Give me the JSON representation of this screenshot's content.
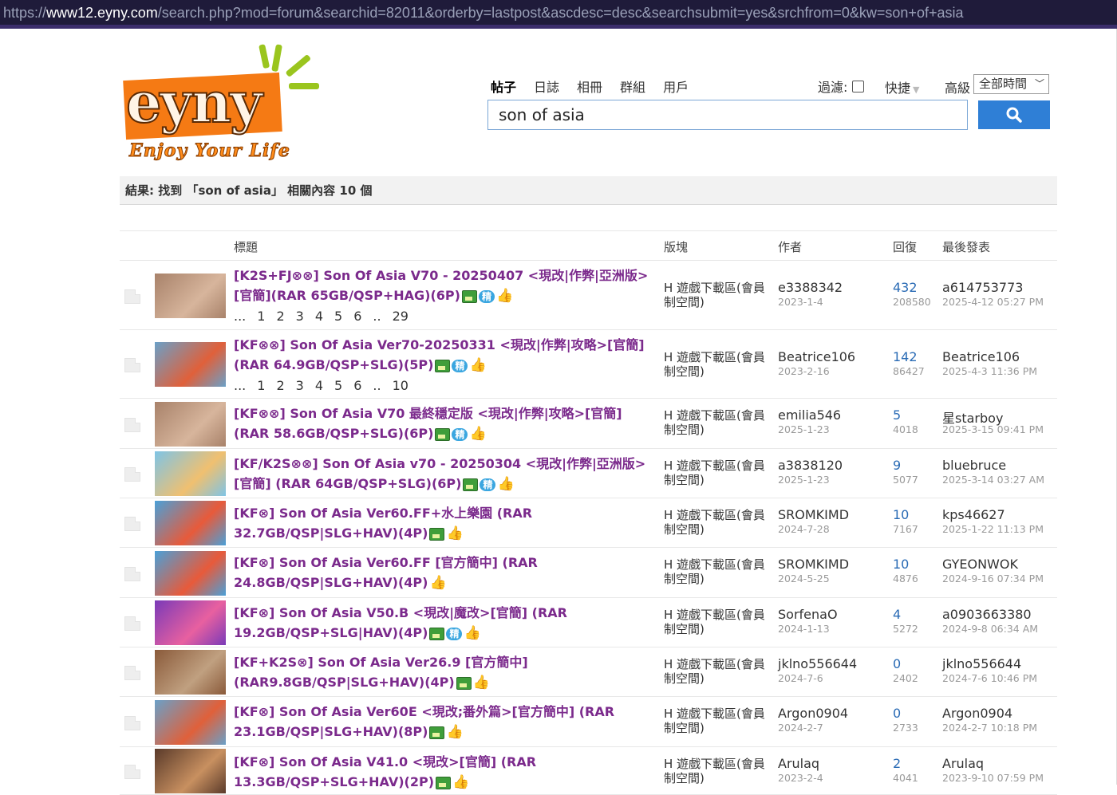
{
  "url": {
    "prefix": "https://",
    "host": "www12.eyny.com",
    "path": "/search.php?mod=forum&searchid=82011&orderby=lastpost&ascdesc=desc&searchsubmit=yes&srchfrom=0&kw=son+of+asia"
  },
  "logo": {
    "word": "eyny",
    "tagline": "Enjoy Your Life"
  },
  "search": {
    "tabs": [
      "帖子",
      "日誌",
      "相冊",
      "群組",
      "用戶"
    ],
    "filter_label": "過濾:",
    "quick_label": "快捷",
    "advanced_label": "高級",
    "time_select": "全部時間",
    "query": "son of asia"
  },
  "result_summary": "結果: 找到 「son of asia」 相關內容 10 個",
  "table": {
    "headers": {
      "title": "標題",
      "forum": "版塊",
      "author": "作者",
      "replies": "回復",
      "last_post": "最後發表"
    },
    "rows": [
      {
        "title": "[K2S+FJ⊗⊗] Son Of Asia V70 - 20250407 <現改|作弊|亞洲版> [官簡](RAR 65GB/QSP+HAG)(6P)",
        "badges": [
          "img",
          "jing",
          "thumb"
        ],
        "pages": [
          "...",
          "1",
          "2",
          "3",
          "4",
          "5",
          "6",
          "..",
          "29"
        ],
        "forum": "H 遊戲下載區(會員制空間)",
        "author": "e3388342",
        "author_date": "2023-1-4",
        "replies": "432",
        "views": "208580",
        "last_by": "a614753773",
        "last_date": "2025-4-12 05:27 PM"
      },
      {
        "title": "[KF⊗⊗] Son Of Asia Ver70-20250331 <現改|作弊|攻略>[官簡] (RAR 64.9GB/QSP+SLG)(5P)",
        "badges": [
          "img",
          "jing",
          "thumb"
        ],
        "pages": [
          "...",
          "1",
          "2",
          "3",
          "4",
          "5",
          "6",
          "..",
          "10"
        ],
        "forum": "H 遊戲下載區(會員制空間)",
        "author": "Beatrice106",
        "author_date": "2023-2-16",
        "replies": "142",
        "views": "86427",
        "last_by": "Beatrice106",
        "last_date": "2025-4-3 11:36 PM"
      },
      {
        "title": "[KF⊗⊗] Son Of Asia V70 最終穩定版 <現改|作弊|攻略>[官簡](RAR 58.6GB/QSP+SLG)(6P)",
        "badges": [
          "img",
          "jing",
          "thumb"
        ],
        "pages": [],
        "forum": "H 遊戲下載區(會員制空間)",
        "author": "emilia546",
        "author_date": "2025-1-23",
        "replies": "5",
        "views": "4018",
        "last_by": "星starboy",
        "last_date": "2025-3-15 09:41 PM"
      },
      {
        "title": "[KF/K2S⊗⊗] Son Of Asia v70 - 20250304 <現改|作弊|亞洲版>[官簡] (RAR 64GB/QSP+SLG)(6P)",
        "badges": [
          "img",
          "jing",
          "thumb"
        ],
        "pages": [],
        "forum": "H 遊戲下載區(會員制空間)",
        "author": "a3838120",
        "author_date": "2025-1-23",
        "replies": "9",
        "views": "5077",
        "last_by": "bluebruce",
        "last_date": "2025-3-14 03:27 AM"
      },
      {
        "title": "[KF⊗] Son Of Asia Ver60.FF+水上樂園 (RAR 32.7GB/QSP|SLG+HAV)(4P)",
        "badges": [
          "img",
          "thumb"
        ],
        "pages": [],
        "forum": "H 遊戲下載區(會員制空間)",
        "author": "SROMKIMD",
        "author_date": "2024-7-28",
        "replies": "10",
        "views": "7167",
        "last_by": "kps46627",
        "last_date": "2025-1-22 11:13 PM"
      },
      {
        "title": "[KF⊗] Son Of Asia Ver60.FF [官方簡中] (RAR 24.8GB/QSP|SLG+HAV)(4P)",
        "badges": [
          "thumb"
        ],
        "pages": [],
        "forum": "H 遊戲下載區(會員制空間)",
        "author": "SROMKIMD",
        "author_date": "2024-5-25",
        "replies": "10",
        "views": "4876",
        "last_by": "GYEONWOK",
        "last_date": "2024-9-16 07:34 PM"
      },
      {
        "title": "[KF⊗] Son Of Asia V50.B <現改|魔改>[官簡] (RAR 19.2GB/QSP+SLG|HAV)(4P)",
        "badges": [
          "img",
          "jing",
          "thumb"
        ],
        "pages": [],
        "forum": "H 遊戲下載區(會員制空間)",
        "author": "SorfenaO",
        "author_date": "2024-1-13",
        "replies": "4",
        "views": "5272",
        "last_by": "a0903663380",
        "last_date": "2024-9-8 06:34 AM"
      },
      {
        "title": "[KF+K2S⊗] Son Of Asia Ver26.9 [官方簡中] (RAR9.8GB/QSP|SLG+HAV)(4P)",
        "badges": [
          "img",
          "thumb"
        ],
        "pages": [],
        "forum": "H 遊戲下載區(會員制空間)",
        "author": "jklno556644",
        "author_date": "2024-7-6",
        "replies": "0",
        "views": "2402",
        "last_by": "jklno556644",
        "last_date": "2024-7-6 10:46 PM"
      },
      {
        "title": "[KF⊗] Son Of Asia Ver60E <現改;番外篇>[官方簡中] (RAR 23.1GB/QSP|SLG+HAV)(8P)",
        "badges": [
          "img",
          "thumb"
        ],
        "pages": [],
        "forum": "H 遊戲下載區(會員制空間)",
        "author": "Argon0904",
        "author_date": "2024-2-7",
        "replies": "0",
        "views": "2733",
        "last_by": "Argon0904",
        "last_date": "2024-2-7 10:18 PM"
      },
      {
        "title": "[KF⊗] Son Of Asia V41.0 <現改>[官簡] (RAR 13.3GB/QSP+SLG+HAV)(2P)",
        "badges": [
          "img",
          "thumb"
        ],
        "pages": [],
        "forum": "H 遊戲下載區(會員制空間)",
        "author": "Arulaq",
        "author_date": "2023-2-4",
        "replies": "2",
        "views": "4041",
        "last_by": "Arulaq",
        "last_date": "2023-9-10 07:59 PM"
      }
    ]
  },
  "colors": {
    "title_link": "#7b2a8c",
    "reply_count": "#2a6bb5",
    "search_button": "#2f7fd6",
    "logo_orange": "#f57a14",
    "url_bar": "#1f1b3a"
  }
}
